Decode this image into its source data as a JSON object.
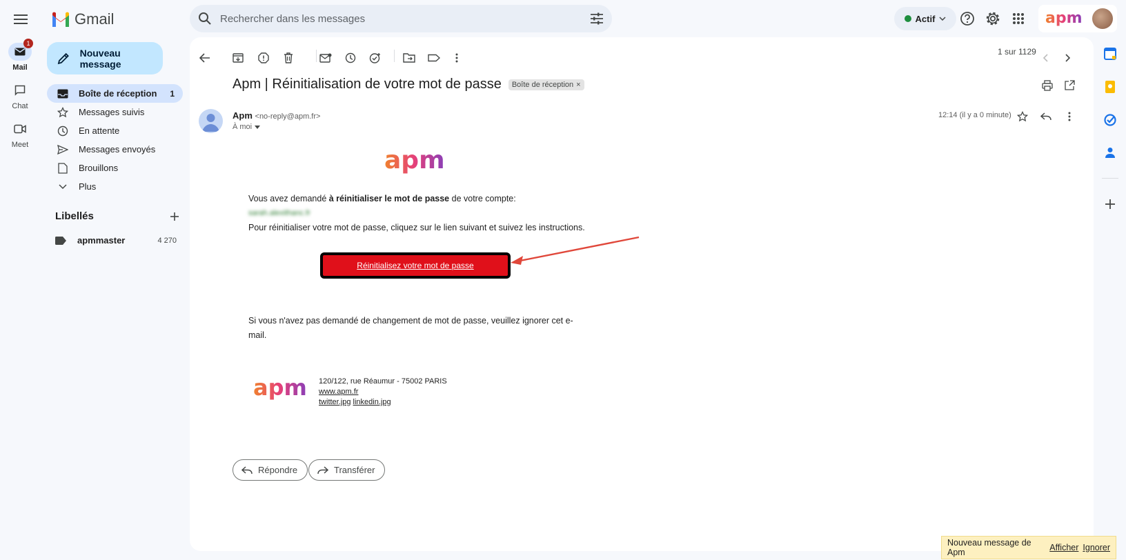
{
  "app": {
    "name": "Gmail"
  },
  "search": {
    "placeholder": "Rechercher dans les messages"
  },
  "status": {
    "label": "Actif",
    "color": "#1e8e3e"
  },
  "account": {
    "logo_text": "apm"
  },
  "rail": {
    "mail": {
      "label": "Mail",
      "badge": "1"
    },
    "chat": {
      "label": "Chat"
    },
    "meet": {
      "label": "Meet"
    }
  },
  "compose": {
    "label": "Nouveau message"
  },
  "nav": [
    {
      "label": "Boîte de réception",
      "count": "1",
      "icon": "inbox-icon"
    },
    {
      "label": "Messages suivis",
      "count": "",
      "icon": "star-icon"
    },
    {
      "label": "En attente",
      "count": "",
      "icon": "clock-icon"
    },
    {
      "label": "Messages envoyés",
      "count": "",
      "icon": "send-icon"
    },
    {
      "label": "Brouillons",
      "count": "",
      "icon": "draft-icon"
    },
    {
      "label": "Plus",
      "count": "",
      "icon": "chevron-down-icon"
    }
  ],
  "labels": {
    "heading": "Libellés",
    "items": [
      {
        "label": "apmmaster",
        "count": "4 270"
      }
    ]
  },
  "toolbar": {
    "pager": "1 sur 1129"
  },
  "message": {
    "subject": "Apm | Réinitialisation de votre mot de passe",
    "tag": "Boîte de réception",
    "tag_close": "×",
    "sender_name": "Apm",
    "sender_address": "<no-reply@apm.fr>",
    "recipient": "À moi",
    "time": "12:14 (il y a 0 minute)"
  },
  "email": {
    "logo_text": "apm",
    "intro_before": "Vous avez demandé ",
    "intro_bold": "à réinitialiser le mot de passe",
    "intro_after": " de votre compte:",
    "account_blurred": "sarah.alexithanc.fr",
    "instructions": "Pour réinitialiser votre mot de passe, cliquez sur le lien suivant et suivez les instructions.",
    "reset_link": "Réinitialisez votre mot de passe",
    "ignore_line1": "Si vous n'avez pas demandé de changement de mot de passe, veuillez ignorer cet e-",
    "ignore_line2": "mail.",
    "footer_address": "120/122, rue Réaumur - 75002 PARIS",
    "footer_site": "www.apm.fr",
    "footer_twitter": "twitter.jpg",
    "footer_linkedin": "linkedin.jpg"
  },
  "actions": {
    "reply": "Répondre",
    "forward": "Transférer"
  },
  "toast": {
    "text": "Nouveau message de Apm",
    "show": "Afficher",
    "ignore": "Ignorer"
  },
  "colors": {
    "accent": "#c2e7ff",
    "reset_button": "#e0101a",
    "annotation_arrow": "#e0473a"
  }
}
